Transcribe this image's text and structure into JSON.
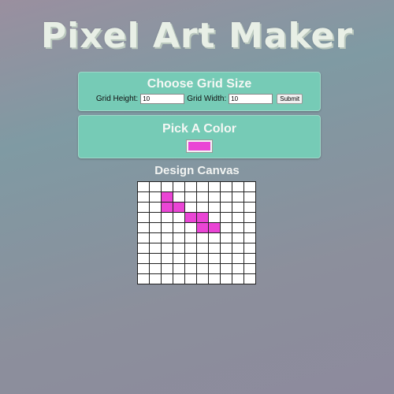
{
  "app": {
    "title": "Pixel Art Maker"
  },
  "grid_size": {
    "heading": "Choose Grid Size",
    "height_label": "Grid Height:",
    "height_value": "10",
    "width_label": "Grid Width:",
    "width_value": "10",
    "submit_label": "Submit"
  },
  "color_picker": {
    "heading": "Pick A Color",
    "selected_color": "#ea45d5"
  },
  "canvas": {
    "heading": "Design Canvas",
    "rows": 10,
    "cols": 10,
    "painted_color": "#ea45d5",
    "painted_cells": [
      [
        1,
        2
      ],
      [
        2,
        2
      ],
      [
        2,
        3
      ],
      [
        3,
        4
      ],
      [
        3,
        5
      ],
      [
        4,
        5
      ],
      [
        4,
        6
      ]
    ]
  }
}
